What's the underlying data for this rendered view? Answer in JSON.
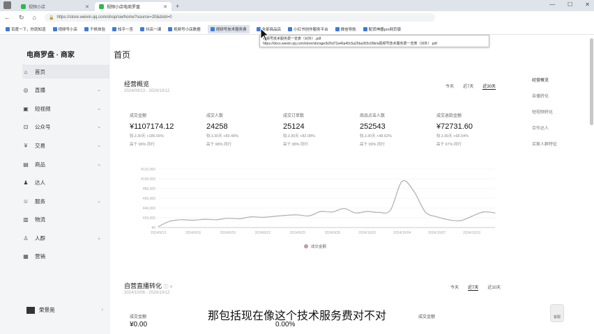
{
  "browser": {
    "tabs": [
      {
        "label": "视频小店"
      },
      {
        "label": "视频小店电商罗盘"
      }
    ],
    "url": "https://store.weixin.qq.com/shop/sw/home?source=20&dsId=0",
    "bookmarks": [
      "百度一下，你就知道",
      "视频号小店",
      "千帆体验",
      "知乎一答",
      "抖店一课",
      "视频号小店数据",
      "视频号技术服务费",
      "全部商品店",
      "小红书创作服务平台",
      "微信导航",
      "配货神器pro网页版"
    ],
    "tooltip_line1": "视频号技术服务费一览表（对外）.pdf",
    "tooltip_line2": "https://docs.weixin.qq.com/store/storage/b26d72a46a40c5a25ba365c09b/a视频号技术服务费一览表（对外）.pdf"
  },
  "sidebar": {
    "brand": "电商罗盘 · 商家",
    "items": [
      {
        "icon": "home-icon",
        "glyph": "⌂",
        "label": "首页"
      },
      {
        "icon": "live-icon",
        "glyph": "◎",
        "label": "直播"
      },
      {
        "icon": "video-icon",
        "glyph": "▣",
        "label": "短视频"
      },
      {
        "icon": "official-account-icon",
        "glyph": "⊡",
        "label": "公众号"
      },
      {
        "icon": "trade-icon",
        "glyph": "¥",
        "label": "交易"
      },
      {
        "icon": "product-icon",
        "glyph": "▤",
        "label": "商品"
      },
      {
        "icon": "influencer-icon",
        "glyph": "♟",
        "label": "达人"
      },
      {
        "icon": "service-icon",
        "glyph": "☺",
        "label": "服务"
      },
      {
        "icon": "logistics-icon",
        "glyph": "▥",
        "label": "物流"
      },
      {
        "icon": "crowd-icon",
        "glyph": "♙",
        "label": "人群"
      },
      {
        "icon": "marketing-icon",
        "glyph": "▦",
        "label": "营销"
      }
    ],
    "user": "荣景苑"
  },
  "main": {
    "title": "首页",
    "overview": {
      "title": "经营概览",
      "date_range": "2024/09/13 - 2024/10/12",
      "periods": [
        "今天",
        "近7天",
        "近30天"
      ],
      "metrics": [
        {
          "label": "成交金额",
          "value": "¥1107174.12",
          "cmp1": "较上30天 +186.55%",
          "cmp2": "高于 98% 同行"
        },
        {
          "label": "成交人数",
          "value": "24258",
          "cmp1": "较上30天 +83.49%",
          "cmp2": "高于 98% 同行"
        },
        {
          "label": "成交订单数",
          "value": "25124",
          "cmp1": "较上30天 +82.08%",
          "cmp2": "高于 98% 同行"
        },
        {
          "label": "商品点击人数",
          "value": "252543",
          "cmp1": "较上30天 +48.62%",
          "cmp2": "高于 99% 同行"
        },
        {
          "label": "成交退款金额",
          "value": "¥72731.60",
          "cmp1": "较上30天 +68.54%",
          "cmp2": "高于 97% 同行"
        }
      ]
    },
    "right_nav": [
      "经营概览",
      "自播转化",
      "短视频转化",
      "合作达人",
      "买家人群特征"
    ],
    "live": {
      "title": "自营直播转化",
      "date_range": "2024/10/06 - 2024/10/12",
      "periods": [
        "今天",
        "近7天",
        "近30天"
      ],
      "metrics": [
        {
          "label": "成交金额",
          "value": "¥0.00"
        },
        {
          "label": "",
          "value": "0.00%"
        },
        {
          "label": "成交金额",
          "value": ""
        }
      ]
    },
    "subtitle": "那包括现在像这个技术服务费对不对",
    "help": "客服"
  },
  "chart_data": {
    "type": "line",
    "x": [
      "2024/9/13",
      "2024/9/14",
      "2024/9/15",
      "2024/9/16",
      "2024/9/17",
      "2024/9/18",
      "2024/9/19",
      "2024/9/20",
      "2024/9/21",
      "2024/9/22",
      "2024/9/23",
      "2024/9/24",
      "2024/9/25",
      "2024/9/26",
      "2024/9/27",
      "2024/9/28",
      "2024/9/29",
      "2024/9/30",
      "2024/10/1",
      "2024/10/2",
      "2024/10/3",
      "2024/10/4",
      "2024/10/5",
      "2024/10/6",
      "2024/10/7",
      "2024/10/8",
      "2024/10/9",
      "2024/10/10",
      "2024/10/11",
      "2024/10/12"
    ],
    "x_tick_labels": [
      "2024/9/13",
      "2024/9/16",
      "2024/9/19",
      "2024/9/22",
      "2024/9/25",
      "2024/9/28",
      "2024/10/01",
      "2024/10/04",
      "2024/10/07",
      "2024/10/10"
    ],
    "series": [
      {
        "name": "成交金额",
        "color": "#b5aab0",
        "values": [
          2000,
          13000,
          16000,
          15000,
          17000,
          16000,
          19000,
          18000,
          22000,
          21000,
          23000,
          25000,
          26000,
          24000,
          33000,
          32000,
          39000,
          30000,
          33000,
          31000,
          36000,
          95000,
          75000,
          32000,
          22000,
          16000,
          14000,
          23000,
          32000,
          30000
        ]
      }
    ],
    "yticks": [
      "¥120,000",
      "¥100,000",
      "¥80,000",
      "¥60,000",
      "¥40,000",
      "¥20,000",
      "¥0"
    ],
    "ylim": [
      0,
      120000
    ],
    "grid": true,
    "legend": "bottom-center"
  }
}
